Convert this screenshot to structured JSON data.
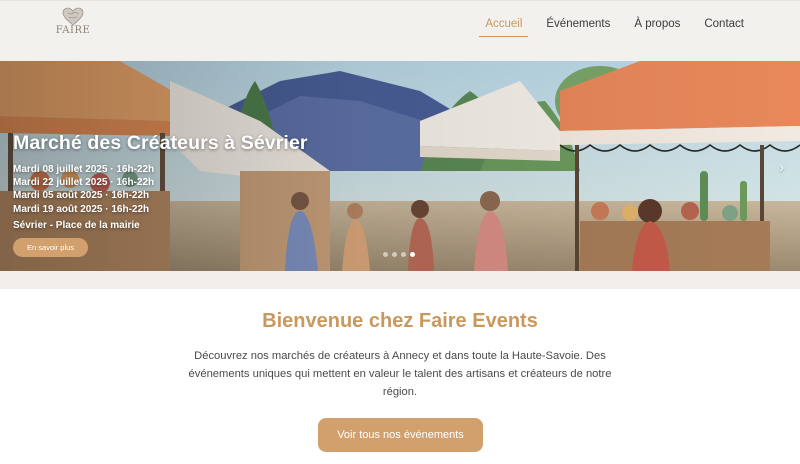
{
  "header": {
    "logo_text": "FAIRE",
    "nav": [
      {
        "label": "Accueil",
        "active": true
      },
      {
        "label": "Événements",
        "active": false
      },
      {
        "label": "À propos",
        "active": false
      },
      {
        "label": "Contact",
        "active": false
      }
    ]
  },
  "hero": {
    "title": "Marché des Créateurs à Sévrier",
    "dates": [
      "Mardi 08 juillet 2025 · 16h-22h",
      "Mardi 22 juillet 2025 · 16h-22h",
      "Mardi 05 août 2025 · 16h-22h",
      "Mardi 19 août 2025 · 16h-22h"
    ],
    "place": "Sévrier - Place de la mairie",
    "button_label": "En savoir plus",
    "next_arrow": "›",
    "slide_count": 4,
    "active_slide": 4
  },
  "welcome": {
    "title": "Bienvenue chez Faire Events",
    "text": "Découvrez nos marchés de créateurs à Annecy et dans toute la Haute-Savoie. Des événements uniques qui mettent en valeur le talent des artisans et créateurs de notre région.",
    "cta_label": "Voir tous nos événements"
  },
  "colors": {
    "accent": "#c9985f",
    "button": "#d2a06d",
    "header_bg": "#f3f1ee"
  },
  "icons": {
    "logo": "heart-logo-icon",
    "next": "chevron-right-icon"
  }
}
